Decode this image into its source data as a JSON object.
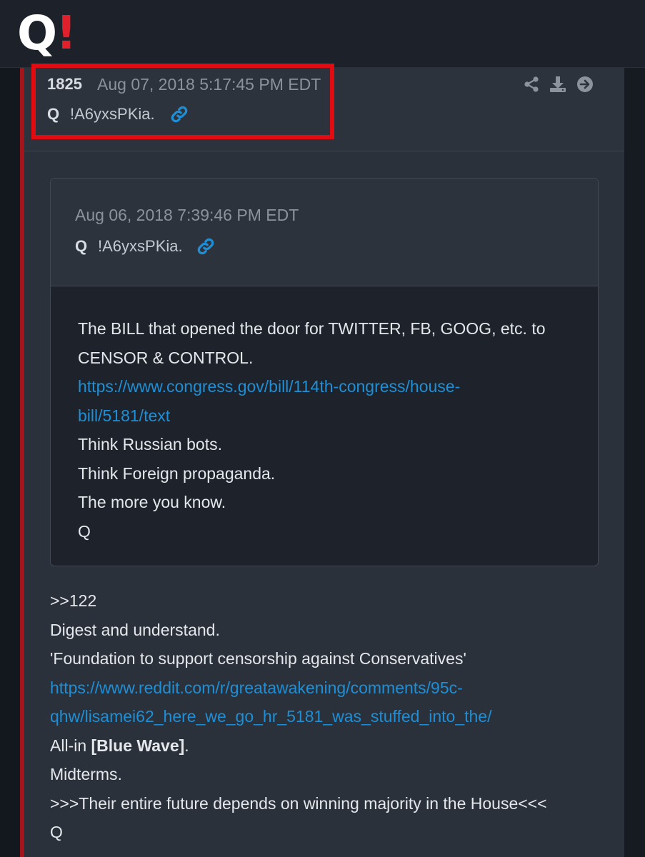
{
  "logo": {
    "q": "Q",
    "bang": "!"
  },
  "post": {
    "number": "1825",
    "date": "Aug 07, 2018 5:17:45 PM EDT",
    "author": "Q",
    "tripcode": "!A6yxsPKia.",
    "actions": [
      "share-icon",
      "download-icon",
      "arrow-right-circle-icon"
    ],
    "body": {
      "line1": ">>122",
      "line2": "Digest and understand.",
      "line3": "'Foundation to support censorship against Conservatives'",
      "link_line1": "https://www.reddit.com/r/greatawakening/comments/95c-",
      "link_line2": "qhw/lisamei62_here_we_go_hr_5181_was_stuffed_into_the/",
      "line_allin_prefix": "All-in ",
      "line_allin_bold": "[Blue Wave]",
      "line_allin_suffix": ".",
      "line_midterms": "Midterms.",
      "line_future": ">>>Their entire future depends on winning majority in the House<<<",
      "signature": "Q"
    }
  },
  "quote": {
    "date": "Aug 06, 2018 7:39:46 PM EDT",
    "author": "Q",
    "tripcode": "!A6yxsPKia.",
    "body": {
      "line1": "The BILL that opened the door for TWITTER, FB, GOOG, etc. to",
      "line2": "CENSOR & CONTROL.",
      "link_line1": "https://www.congress.gov/bill/114th-congress/house-",
      "link_line2": "bill/5181/text",
      "line3": "Think Russian bots.",
      "line4": "Think Foreign propaganda.",
      "line5": "The more you know.",
      "signature": "Q"
    }
  },
  "colors": {
    "accent_red": "#e30b12",
    "link_blue": "#1e8fd6",
    "left_bar": "#a6141b"
  }
}
